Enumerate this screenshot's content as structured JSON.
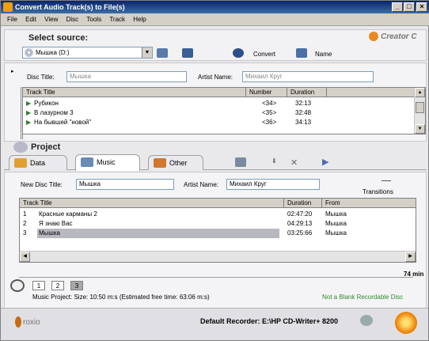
{
  "window": {
    "title": "Convert Audio Track(s) to File(s)"
  },
  "menu": [
    "File",
    "Edit",
    "View",
    "Disc",
    "Tools",
    "Track",
    "Help"
  ],
  "source": {
    "heading": "Select source:",
    "drive": "Мышка (D:)",
    "convert_label": "Convert",
    "name_label": "Name",
    "brand": "Creator C"
  },
  "disc": {
    "title_label": "Disc Title:",
    "title_value": "Мышка",
    "artist_label": "Artist Name:",
    "artist_value": "Михаил Круг"
  },
  "source_tracks": {
    "columns": [
      "Track Title",
      "Number",
      "Duration"
    ],
    "rows": [
      {
        "title": "Рубикон",
        "number": "<34>",
        "duration": "32:13"
      },
      {
        "title": "В лазурном 3",
        "number": "<35>",
        "duration": "32:48"
      },
      {
        "title": "На бывшей \"новой\"",
        "number": "<36>",
        "duration": "34:13"
      }
    ]
  },
  "project": {
    "heading": "Project",
    "tabs": [
      "Data",
      "Music",
      "Other"
    ],
    "new_disc_label": "New Disc Title:",
    "new_disc_value": "Мышка",
    "artist_label": "Artist Name:",
    "artist_value": "Михаил Круг",
    "transitions_label": "Transitions"
  },
  "project_tracks": {
    "columns": [
      "Track Title",
      "Duration",
      "From"
    ],
    "rows": [
      {
        "n": "1",
        "title": "Красные карманы 2",
        "duration": "02:47:20",
        "from": "Мышка"
      },
      {
        "n": "2",
        "title": "Я знаю Вас",
        "duration": "04:29:13",
        "from": "Мышка"
      },
      {
        "n": "3",
        "title": "Мышка",
        "duration": "03:25:66",
        "from": "Мышка"
      }
    ]
  },
  "capacity": {
    "minutes": "74 min",
    "disc_tabs": [
      "1",
      "2",
      "3"
    ]
  },
  "status": {
    "project_size": "Music Project: Size: 10:50 m:s (Estimated free time: 63:06 m:s)",
    "disc_status": "Not a Blank Recordable Disc",
    "recorder": "Default Recorder: E:\\HP CD-Writer+ 8200",
    "logo": "roxio"
  },
  "colors": {
    "accent": "#0a246a",
    "status_green": "#2e8b2e",
    "selected_row": "#b8b8c0"
  }
}
